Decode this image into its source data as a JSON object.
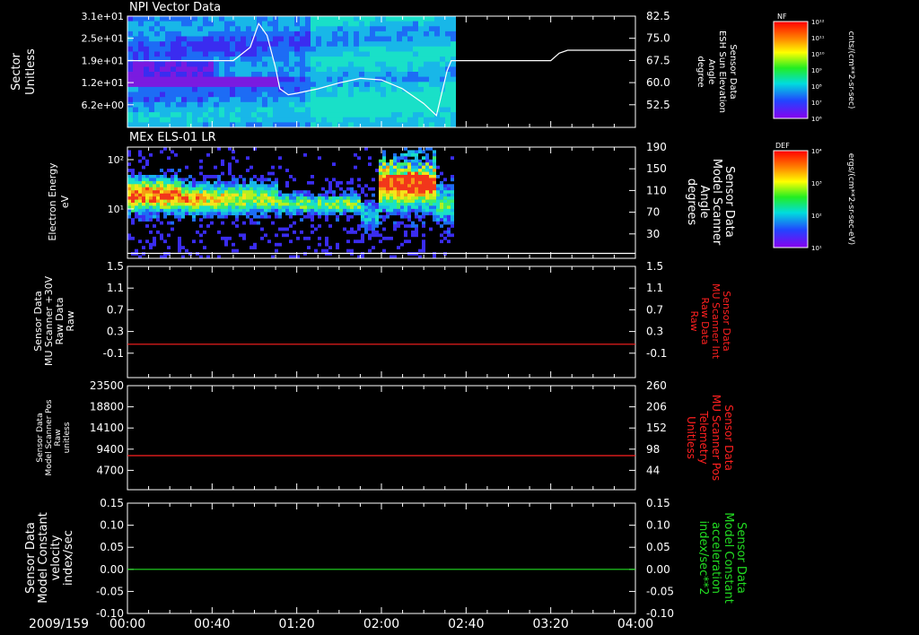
{
  "colors": {
    "white": "#ffffff",
    "red": "#ff2020",
    "green": "#22dd22",
    "background": "#000000"
  },
  "time_axis": {
    "date_label": "2009/159",
    "ticks": [
      "00:00",
      "00:40",
      "01:20",
      "02:00",
      "02:40",
      "03:20",
      "04:00"
    ],
    "range_minutes": [
      0,
      240
    ],
    "data_end_minutes": 153
  },
  "chart_data": [
    {
      "type": "heatmap",
      "title": "NPI Vector Data",
      "ylabel_lines": [
        "Sector",
        "Unitless"
      ],
      "yticks": [
        "3.1e+01",
        "2.5e+01",
        "1.9e+01",
        "1.2e+01",
        "6.2e+00"
      ],
      "overlay": {
        "type": "line",
        "right_label_lines": [
          "Sensor Data",
          "ESH Sun Elevation",
          "Angle",
          "degree"
        ],
        "right_ticks": [
          "82.5",
          "75.0",
          "67.5",
          "60.0",
          "52.5"
        ],
        "ylim": [
          45,
          82.5
        ],
        "x": [
          0,
          15,
          30,
          50,
          58,
          62,
          66,
          70,
          72,
          76,
          80,
          90,
          100,
          110,
          120,
          130,
          140,
          146,
          149,
          151,
          153,
          160,
          200,
          204,
          208,
          240
        ],
        "y": [
          67.5,
          67.5,
          67.5,
          67.5,
          72,
          80,
          76,
          65,
          58,
          56,
          56.5,
          58,
          60,
          61.5,
          61,
          58,
          53,
          49,
          58,
          64,
          67.5,
          67.5,
          67.5,
          70,
          71,
          71
        ]
      },
      "colorbar": {
        "label": "NF",
        "units": "cnts/(cm**2-sr-sec)",
        "ticks": [
          "10¹²",
          "10¹¹",
          "10¹⁰",
          "10⁹",
          "10⁸",
          "10⁷",
          "10⁶"
        ]
      }
    },
    {
      "type": "heatmap",
      "title": "MEx ELS-01 LR",
      "ylabel_lines": [
        "Electron Energy",
        "eV"
      ],
      "yticks": [
        "10²",
        "10¹"
      ],
      "overlay": {
        "type": "line",
        "right_label_lines": [
          "Sensor Data",
          "Model Scanner",
          "Angle",
          "degrees"
        ],
        "right_ticks": [
          "190",
          "150",
          "110",
          "70",
          "30"
        ],
        "ylim": [
          10,
          190
        ],
        "x": [
          0,
          240
        ],
        "y": [
          18,
          18
        ]
      },
      "colorbar": {
        "label": "DEF",
        "units": "ergs/(cm**2-sr-sec-eV)",
        "ticks": [
          "10⁴",
          "10³",
          "10²",
          "10¹"
        ]
      }
    },
    {
      "type": "line",
      "ylabel_lines": [
        "Sensor Data",
        "MU Scanner +30V",
        "Raw Data",
        "Raw"
      ],
      "yticks": [
        "1.5",
        "1.1",
        "0.7",
        "0.3",
        "-0.1"
      ],
      "ylim": [
        -0.5,
        1.5
      ],
      "right_label_lines": [
        "Sensor Data",
        "MU Scanner Int",
        "Raw Data",
        "Raw"
      ],
      "right_ticks": [
        "1.5",
        "1.1",
        "0.7",
        "0.3",
        "-0.1"
      ],
      "series": [
        {
          "x": [
            0,
            240
          ],
          "y": [
            0.1,
            0.1
          ]
        }
      ]
    },
    {
      "type": "line",
      "ylabel_lines": [
        "Sensor Data",
        "Model Scanner Pos",
        "Raw",
        "unitless"
      ],
      "yticks": [
        "23500",
        "18800",
        "14100",
        "9400",
        "4700"
      ],
      "ylim": [
        0,
        23500
      ],
      "right_label_lines": [
        "Sensor Data",
        "MU Scanner Pos",
        "Telemetry",
        "Unitless"
      ],
      "right_ticks": [
        "260",
        "206",
        "152",
        "98",
        "44"
      ],
      "series": [
        {
          "x": [
            0,
            240
          ],
          "y": [
            7700,
            7700
          ]
        }
      ]
    },
    {
      "type": "line",
      "ylabel_lines": [
        "Sensor Data",
        "Model Constant",
        "velocity",
        "index/sec"
      ],
      "yticks": [
        "0.15",
        "0.10",
        "0.05",
        "0.00",
        "-0.05",
        "-0.10"
      ],
      "ylim": [
        -0.1,
        0.15
      ],
      "right_label_lines": [
        "Sensor Data",
        "Model Constant",
        "acceleration",
        "index/sec**2"
      ],
      "right_ticks": [
        "0.15",
        "0.10",
        "0.05",
        "0.00",
        "-0.05",
        "-0.10"
      ],
      "series": [
        {
          "x": [
            0,
            240
          ],
          "y": [
            0,
            0
          ]
        }
      ]
    }
  ]
}
